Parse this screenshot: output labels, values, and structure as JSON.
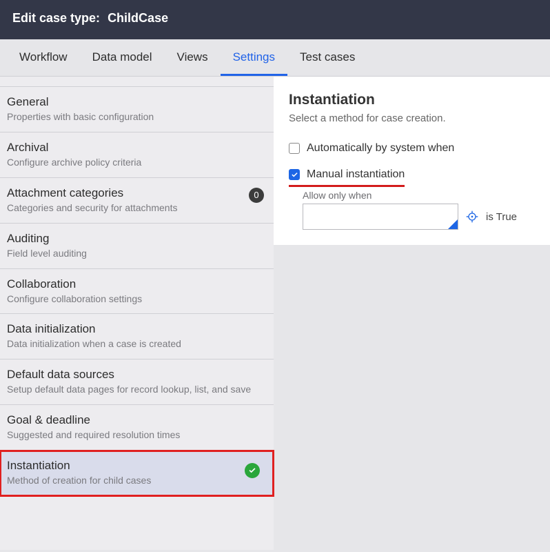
{
  "header": {
    "label": "Edit case type:",
    "name": "ChildCase"
  },
  "tabs": [
    "Workflow",
    "Data model",
    "Views",
    "Settings",
    "Test cases"
  ],
  "activeTab": "Settings",
  "sidebar": [
    {
      "title": "General",
      "sub": "Properties with basic configuration"
    },
    {
      "title": "Archival",
      "sub": "Configure archive policy criteria"
    },
    {
      "title": "Attachment categories",
      "sub": "Categories and security for attachments",
      "badge": "0"
    },
    {
      "title": "Auditing",
      "sub": "Field level auditing"
    },
    {
      "title": "Collaboration",
      "sub": "Configure collaboration settings"
    },
    {
      "title": "Data initialization",
      "sub": "Data initialization when a case is created"
    },
    {
      "title": "Default data sources",
      "sub": "Setup default data pages for record lookup, list, and save"
    },
    {
      "title": "Goal & deadline",
      "sub": "Suggested and required resolution times"
    },
    {
      "title": "Instantiation",
      "sub": "Method of creation for child cases",
      "selected": true,
      "check": true
    }
  ],
  "panel": {
    "title": "Instantiation",
    "sub": "Select a method for case creation.",
    "opt1": {
      "label": "Automatically by system when",
      "checked": false
    },
    "opt2": {
      "label": "Manual instantiation",
      "checked": true
    },
    "allow": {
      "label": "Allow only when",
      "value": "",
      "isTrue": "is True"
    }
  }
}
